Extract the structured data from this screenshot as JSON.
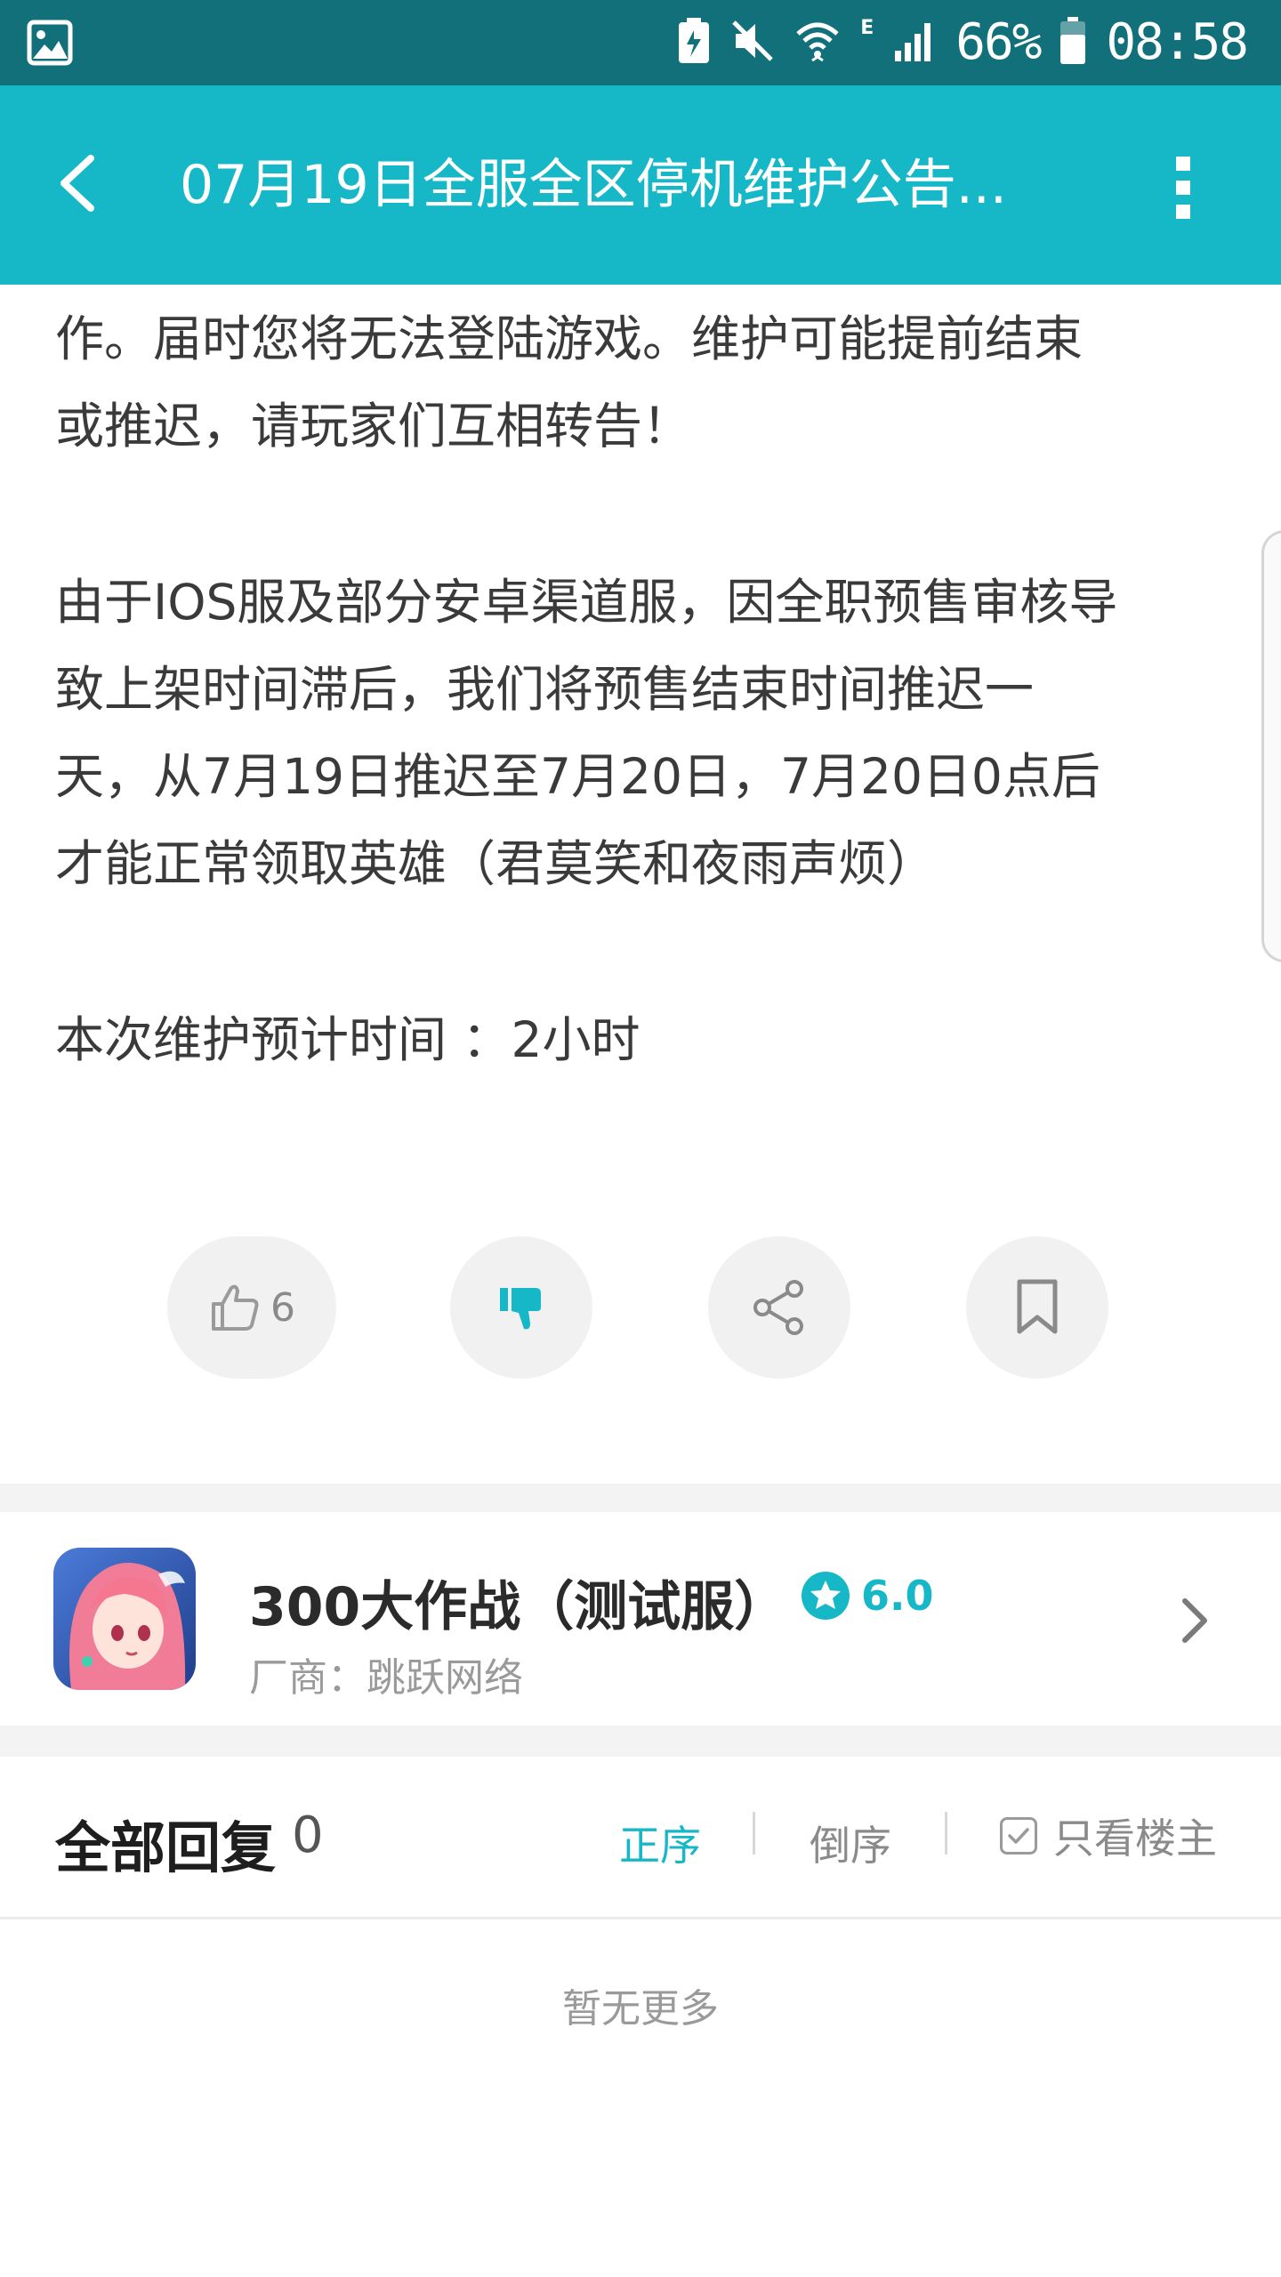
{
  "status_bar": {
    "network_type": "E",
    "battery_percent": "66%",
    "time": "08:58"
  },
  "app_bar": {
    "title": "07月19日全服全区停机维护公告..."
  },
  "article": {
    "lines": [
      "作。届时您将无法登陆游戏。维护可能提前结束",
      "或推迟，请玩家们互相转告！",
      "由于IOS服及部分安卓渠道服，因全职预售审核导",
      "致上架时间滞后，我们将预售结束时间推迟一",
      "天，从7月19日推迟至7月20日，7月20日0点后",
      "才能正常领取英雄（君莫笑和夜雨声烦）",
      "本次维护预计时间 ：2小时"
    ]
  },
  "actions": {
    "like_count": "6"
  },
  "game": {
    "name": "300大作战（测试服）",
    "rating": "6.0",
    "vendor": "厂商：跳跃网络"
  },
  "replies": {
    "title": "全部回复",
    "count": "0",
    "sort_asc": "正序",
    "sort_desc": "倒序",
    "only_op": "只看楼主"
  },
  "footer": {
    "no_more": "暂无更多"
  },
  "colors": {
    "status_bar": "#12707a",
    "accent": "#16b8c8",
    "background": "#ffffff"
  }
}
